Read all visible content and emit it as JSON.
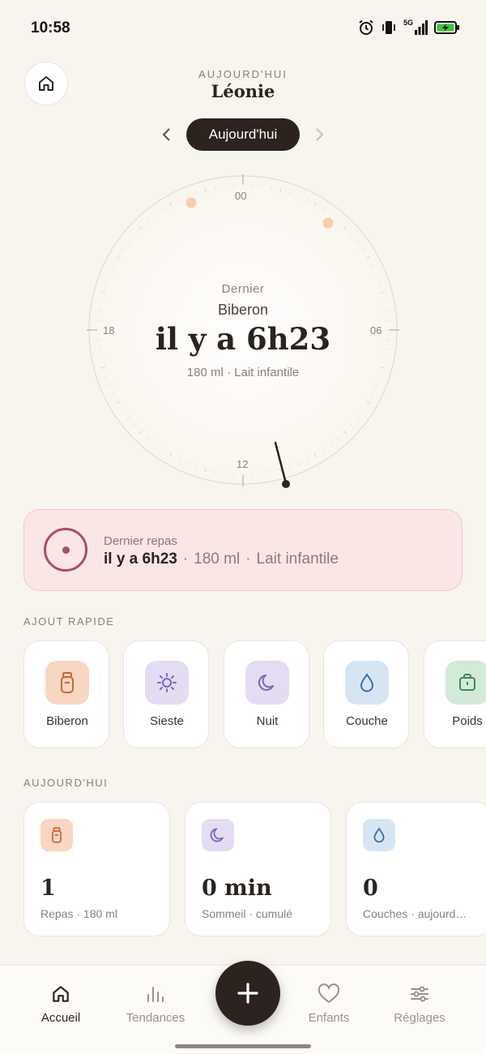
{
  "status_bar": {
    "time": "10:58",
    "network": "5G"
  },
  "header": {
    "subtitle": "AUJOURD'HUI",
    "child_name": "Léonie"
  },
  "date_nav": {
    "current_label": "Aujourd'hui"
  },
  "dial": {
    "kicker": "Dernier",
    "type": "Biberon",
    "elapsed": "il y a 6h23",
    "detail": "180 ml · Lait infantile",
    "hour_labels": {
      "top": "00",
      "right": "06",
      "bottom": "12",
      "left": "18"
    }
  },
  "last_meal": {
    "title": "Dernier repas",
    "elapsed": "il y a 6h23",
    "sep": "·",
    "volume": "180 ml",
    "kind": "Lait infantile"
  },
  "quick_add": {
    "title": "AJOUT RAPIDE",
    "items": [
      {
        "label": "Biberon",
        "icon": "bottle-icon",
        "color": "#f8d6c2"
      },
      {
        "label": "Sieste",
        "icon": "sun-icon",
        "color": "#e3dcf2"
      },
      {
        "label": "Nuit",
        "icon": "moon-icon",
        "color": "#e3dcf2"
      },
      {
        "label": "Couche",
        "icon": "drop-icon",
        "color": "#d7e5f3"
      },
      {
        "label": "Poids",
        "icon": "scale-icon",
        "color": "#d4ead9"
      }
    ]
  },
  "today": {
    "title": "AUJOURD'HUI",
    "stats": [
      {
        "value": "1",
        "label": "Repas · 180 ml",
        "icon": "bottle-icon",
        "color": "#f8d6c2"
      },
      {
        "value": "0 min",
        "label": "Sommeil · cumulé",
        "icon": "moon-icon",
        "color": "#e3dcf2"
      },
      {
        "value": "0",
        "label": "Couches · aujourd…",
        "icon": "drop-icon",
        "color": "#d7e5f3"
      }
    ]
  },
  "bottom_nav": {
    "items": [
      {
        "label": "Accueil",
        "icon": "home-icon"
      },
      {
        "label": "Tendances",
        "icon": "bar-chart-icon"
      },
      {
        "label": "Enfants",
        "icon": "heart-icon"
      },
      {
        "label": "Réglages",
        "icon": "sliders-icon"
      }
    ],
    "fab_icon": "plus-icon"
  }
}
